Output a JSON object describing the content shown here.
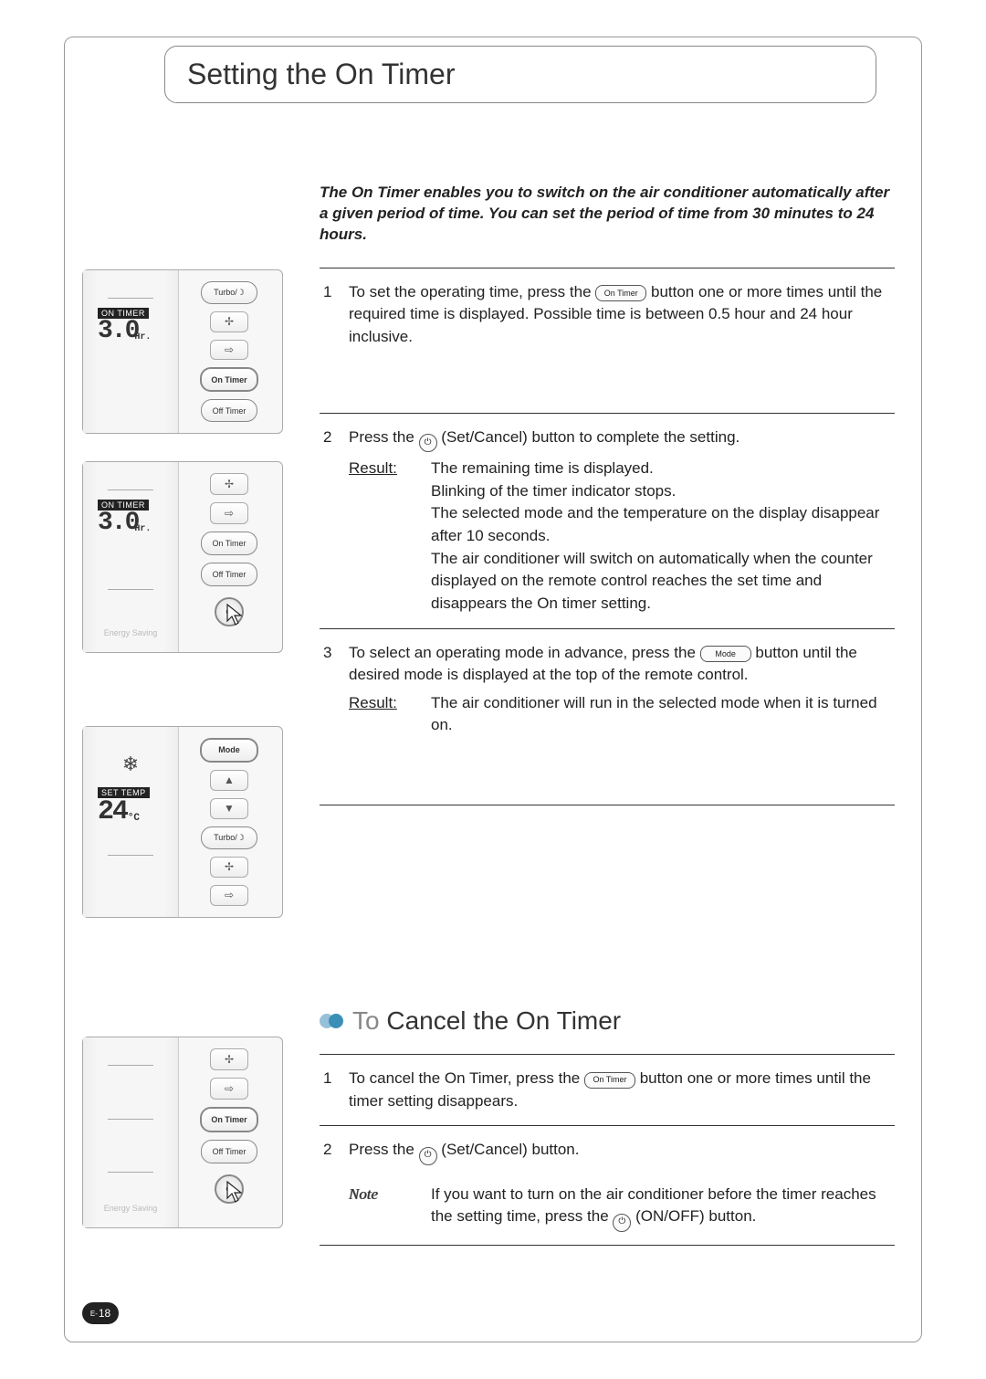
{
  "page": {
    "prefix": "E-",
    "number": "18"
  },
  "section1": {
    "title": "Setting the On Timer",
    "intro": "The On Timer enables you to switch on the air conditioner automatically after a given period of time. You can set the period of time from 30 minutes to 24 hours.",
    "steps": [
      {
        "num": "1",
        "pre": "To set the operating time, press the ",
        "btn": "On Timer",
        "post": " button one or more times until the required time is displayed. Possible time is between 0.5 hour and 24 hour inclusive."
      },
      {
        "num": "2",
        "pre": "Press the ",
        "icon": "set-cancel-icon",
        "post": "(Set/Cancel) button to complete the setting.",
        "result_label": "Result:",
        "result": "The remaining time is displayed.\nBlinking of the timer indicator stops.\nThe selected mode and the temperature on the display disappear after 10 seconds.\nThe air conditioner will switch on automatically when the counter displayed on the remote control reaches the set time and disappears the On timer setting."
      },
      {
        "num": "3",
        "pre": "To select an operating mode in advance, press the ",
        "btn": "Mode",
        "post": " button until the desired mode is displayed at the top of the remote control.",
        "result_label": "Result:",
        "result": "The air conditioner will run in the selected mode when it is turned on."
      }
    ]
  },
  "section2": {
    "title_light": "To",
    "title_rest": " Cancel the On Timer",
    "steps": [
      {
        "num": "1",
        "pre": "To cancel the On Timer, press the ",
        "btn": "On Timer",
        "post": " button one or more times until the timer setting disappears."
      },
      {
        "num": "2",
        "pre": "Press the ",
        "icon": "set-cancel-icon",
        "post": "(Set/Cancel) button.",
        "note_label": "Note",
        "note_pre": "If you want to turn on the air conditioner before the timer reaches the setting time, press the ",
        "note_icon": "power-icon",
        "note_post": "(ON/OFF) button."
      }
    ]
  },
  "remote": {
    "turbo": "Turbo",
    "on_timer_btn": "On Timer",
    "off_timer_btn": "Off Timer",
    "mode_btn": "Mode",
    "energy_saving": "Energy Saving",
    "lcd": {
      "on_timer_label": "ON  TIMER",
      "set_temp_label": "SET  TEMP",
      "time": "3.0",
      "time_unit": "Hr.",
      "temp": "24",
      "temp_unit": "°C"
    }
  }
}
